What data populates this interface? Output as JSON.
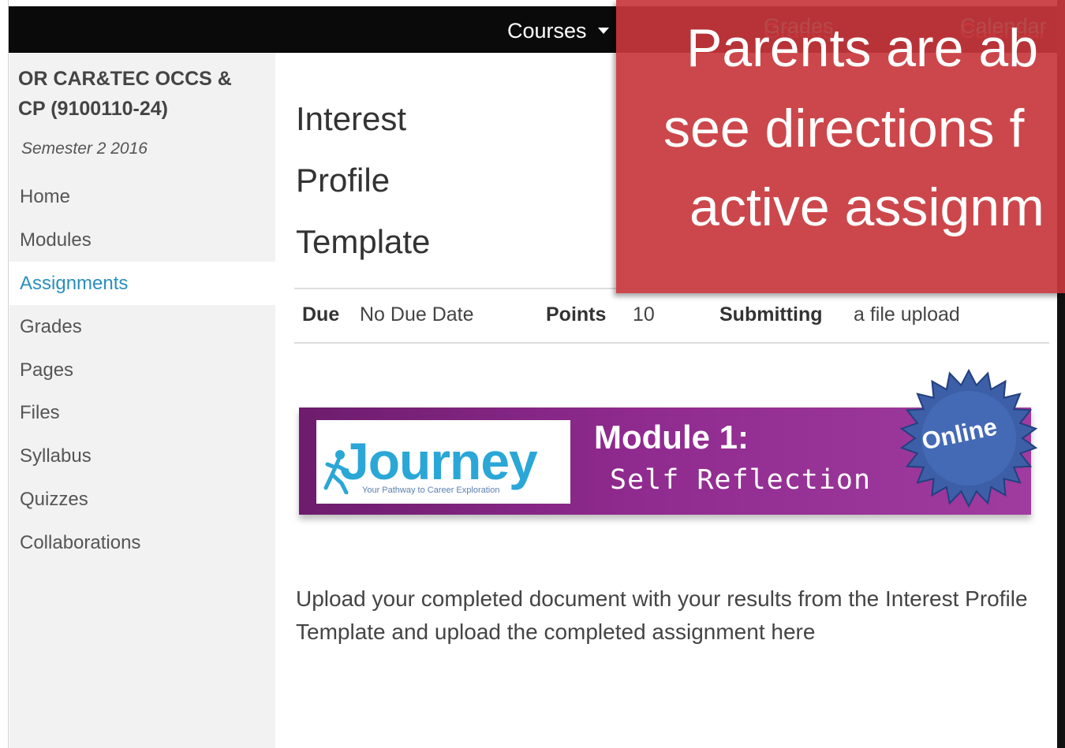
{
  "topnav": {
    "courses_label": "Courses",
    "grades_label": "Grades",
    "calendar_label": "Calendar"
  },
  "sidebar": {
    "course_title": "OR CAR&TEC OCCS & CP (9100110-24)",
    "term": "Semester 2 2016",
    "items": [
      {
        "label": "Home"
      },
      {
        "label": "Modules"
      },
      {
        "label": "Assignments",
        "active": true
      },
      {
        "label": "Grades"
      },
      {
        "label": "Pages"
      },
      {
        "label": "Files"
      },
      {
        "label": "Syllabus"
      },
      {
        "label": "Quizzes"
      },
      {
        "label": "Collaborations"
      }
    ]
  },
  "assignment": {
    "title_lines": [
      "Interest",
      "Profile",
      "Template"
    ],
    "due_label": "Due",
    "due_value": "No Due Date",
    "points_label": "Points",
    "points_value": "10",
    "submitting_label": "Submitting",
    "submitting_value": "a file upload",
    "description": "Upload your completed document with your results from the Interest Profile Template and upload the completed assignment here"
  },
  "banner": {
    "logo_word": "Journey",
    "logo_tagline": "Your Pathway to Career Exploration",
    "module_title": "Module 1:",
    "module_subtitle": "Self Reflection",
    "badge_text": "Online"
  },
  "overlay": {
    "lines": [
      "Parents are ab",
      "see directions f",
      "active assignm"
    ]
  },
  "colors": {
    "nav_bg": "#0a0a0a",
    "sidebar_bg": "#f2f2f2",
    "active_link": "#2a8fbd",
    "overlay_bg": "#c8373c",
    "banner_purple": "#8f2a8e"
  }
}
